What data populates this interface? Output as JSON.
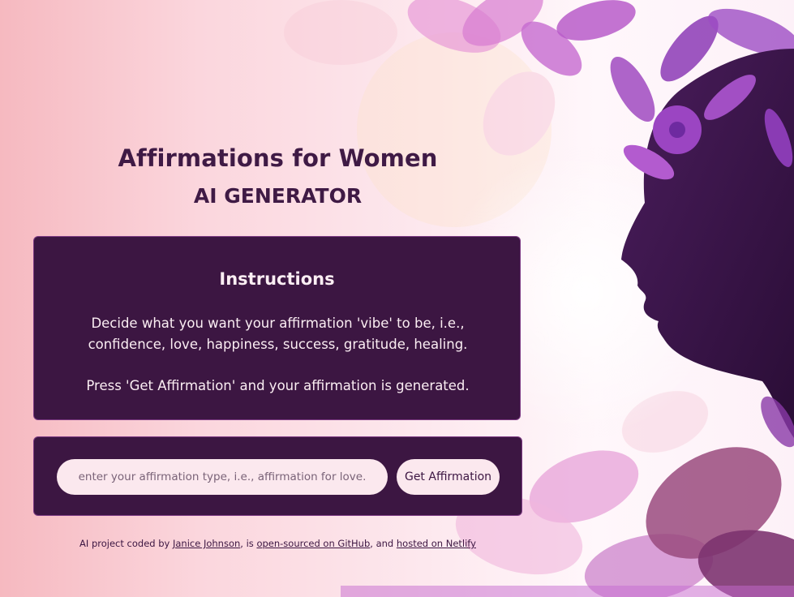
{
  "header": {
    "title": "Affirmations for Women",
    "subtitle": "AI GENERATOR"
  },
  "instructions": {
    "heading": "Instructions",
    "paragraph_1": "Decide what you want your affirmation 'vibe' to be, i.e., confidence, love, happiness, success, gratitude, healing.",
    "paragraph_2": "Press 'Get Affirmation' and your affirmation is generated."
  },
  "form": {
    "input_placeholder": "enter your affirmation type, i.e., affirmation for love.",
    "input_value": "",
    "button_label": "Get Affirmation"
  },
  "footer": {
    "prefix": "AI project coded by ",
    "author_link": "Janice Johnson",
    "middle_1": ", is ",
    "github_link": "open-sourced on GitHub",
    "middle_2": ", and ",
    "netlify_link": "hosted on Netlify"
  },
  "icons": {
    "background_art": "woman-silhouette-floral-illustration"
  },
  "colors": {
    "primary": "#3c1642",
    "card_border": "#7c3a83",
    "input_bg": "#fbe8ee",
    "card_text": "#fbeef3",
    "bg_left": "#f6b9c0",
    "bg_right": "#fdf1f8"
  }
}
